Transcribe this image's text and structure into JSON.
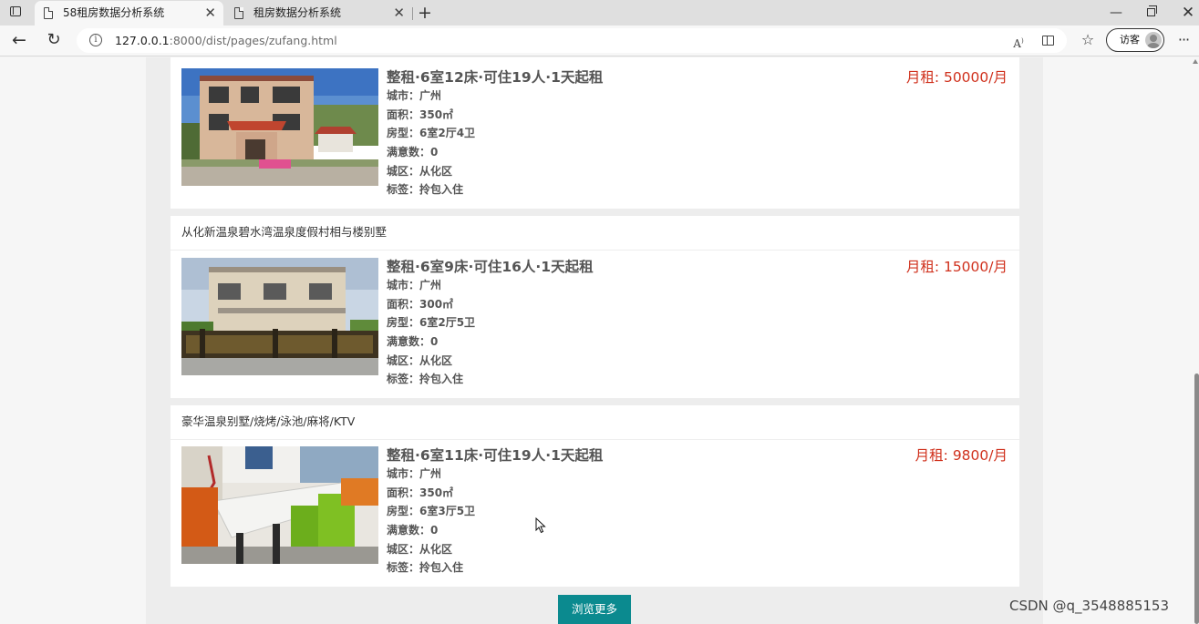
{
  "browser": {
    "tabs": [
      {
        "title": "58租房数据分析系统",
        "active": true
      },
      {
        "title": "租房数据分析系统",
        "active": false
      }
    ],
    "url_host": "127.0.0.1",
    "url_rest": ":8000/dist/pages/zufang.html",
    "profile_label": "访客"
  },
  "listings": [
    {
      "title": "",
      "headline": "整租·6室12床·可住19人·1天起租",
      "price": "月租: 50000/月",
      "city": "城市：广州",
      "area": "面积：350㎡",
      "layout": "房型：6室2厅4卫",
      "satisfaction": "满意数：0",
      "district": "城区：从化区",
      "tag": "标签：拎包入住"
    },
    {
      "title": "从化新温泉碧水湾温泉度假村相与楼别墅",
      "headline": "整租·6室9床·可住16人·1天起租",
      "price": "月租: 15000/月",
      "city": "城市：广州",
      "area": "面积：300㎡",
      "layout": "房型：6室2厅5卫",
      "satisfaction": "满意数：0",
      "district": "城区：从化区",
      "tag": "标签：拎包入住"
    },
    {
      "title": "豪华温泉别墅/烧烤/泳池/麻将/KTV",
      "headline": "整租·6室11床·可住19人·1天起租",
      "price": "月租: 9800/月",
      "city": "城市：广州",
      "area": "面积：350㎡",
      "layout": "房型：6室3厅5卫",
      "satisfaction": "满意数：0",
      "district": "城区：从化区",
      "tag": "标签：拎包入住"
    }
  ],
  "browse_more_label": "浏览更多",
  "watermark": "CSDN @q_3548885153"
}
